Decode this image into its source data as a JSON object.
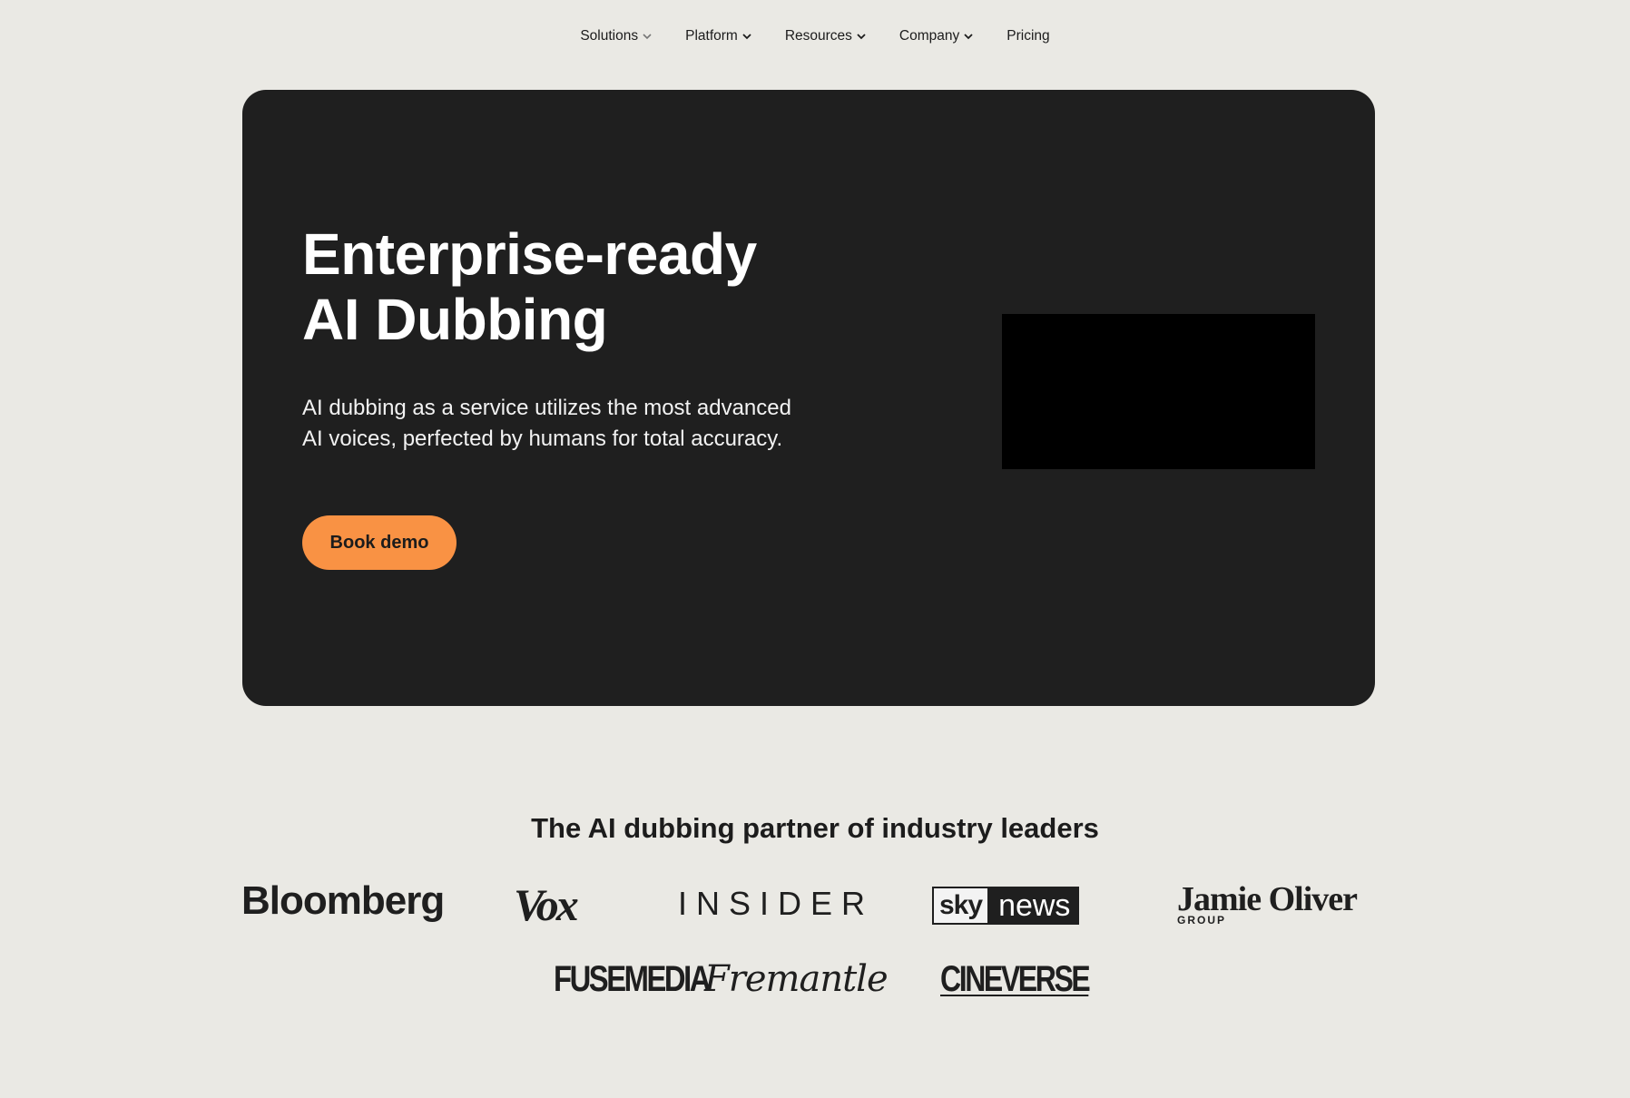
{
  "nav": {
    "items": [
      {
        "label": "Solutions",
        "has_dropdown": true
      },
      {
        "label": "Platform",
        "has_dropdown": true
      },
      {
        "label": "Resources",
        "has_dropdown": true
      },
      {
        "label": "Company",
        "has_dropdown": true
      },
      {
        "label": "Pricing",
        "has_dropdown": false
      }
    ]
  },
  "hero": {
    "title_line1": "Enterprise-ready",
    "title_line2": "AI Dubbing",
    "subtitle": "AI dubbing as a service utilizes the most advanced AI voices, perfected by humans for total accuracy.",
    "cta_label": "Book demo",
    "cta_color": "#F99244",
    "background_color": "#1F1F1F"
  },
  "partners": {
    "title": "The AI dubbing partner of industry leaders",
    "logos": {
      "bloomberg": "Bloomberg",
      "vox": "Vox",
      "insider": "INSIDER",
      "sky": "sky",
      "news": "news",
      "jamie": "Jamie Oliver",
      "jamie_group": "GROUP",
      "fusemedia": "FUSEMEDIA",
      "fremantle": "Fremantle",
      "cineverse": "CINEVERSE"
    }
  }
}
